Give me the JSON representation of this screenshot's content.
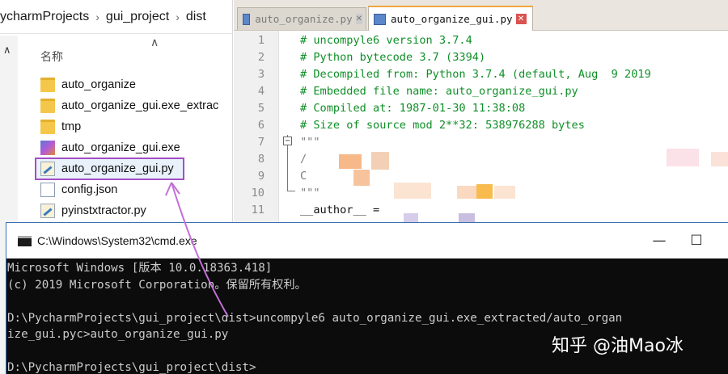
{
  "explorer": {
    "breadcrumb": [
      "ycharmProjects",
      "gui_project",
      "dist"
    ],
    "column_header": "名称",
    "files": [
      {
        "name": "auto_organize",
        "icon": "folder-icon"
      },
      {
        "name": "auto_organize_gui.exe_extrac",
        "icon": "folder-icon"
      },
      {
        "name": "tmp",
        "icon": "folder-icon"
      },
      {
        "name": "auto_organize_gui.exe",
        "icon": "exe-icon"
      },
      {
        "name": "auto_organize_gui.py",
        "icon": "python-file-icon",
        "selected": true
      },
      {
        "name": "config.json",
        "icon": "json-file-icon"
      },
      {
        "name": "pyinstxtractor.py",
        "icon": "python-file-icon"
      }
    ]
  },
  "editor": {
    "tabs": [
      {
        "label": "auto_organize.py",
        "active": false
      },
      {
        "label": "auto_organize_gui.py",
        "active": true
      }
    ],
    "lines": [
      {
        "n": "1",
        "text": "# uncompyle6 version 3.7.4",
        "kind": "cmt"
      },
      {
        "n": "2",
        "text": "# Python bytecode 3.7 (3394)",
        "kind": "cmt"
      },
      {
        "n": "3",
        "text": "# Decompiled from: Python 3.7.4 (default, Aug  9 2019",
        "kind": "cmt"
      },
      {
        "n": "4",
        "text": "# Embedded file name: auto_organize_gui.py",
        "kind": "cmt"
      },
      {
        "n": "5",
        "text": "# Compiled at: 1987-01-30 11:38:08",
        "kind": "cmt"
      },
      {
        "n": "6",
        "text": "# Size of source mod 2**32: 538976288 bytes",
        "kind": "cmt"
      },
      {
        "n": "7",
        "text": "\"\"\"",
        "kind": "str"
      },
      {
        "n": "8",
        "text": "/",
        "kind": "str"
      },
      {
        "n": "9",
        "text": "C",
        "kind": "str"
      },
      {
        "n": "10",
        "text": "\"\"\"",
        "kind": "str"
      },
      {
        "n": "11",
        "text": "__author__ =",
        "kind": "plain"
      }
    ],
    "fold_marker": "−"
  },
  "console": {
    "title": "C:\\Windows\\System32\\cmd.exe",
    "buttons": {
      "minimize": "—",
      "maximize": "☐",
      "close": "✕"
    },
    "lines": [
      "Microsoft Windows [版本 10.0.18363.418]",
      "(c) 2019 Microsoft Corporation。保留所有权利。",
      "",
      "D:\\PycharmProjects\\gui_project\\dist>uncompyle6 auto_organize_gui.exe_extracted/auto_organ",
      "ize_gui.pyc>auto_organize_gui.py",
      "",
      "D:\\PycharmProjects\\gui_project\\dist>"
    ]
  },
  "watermark": "知乎 @油Mao冰",
  "colors": {
    "comment": "#0f8f27",
    "selection_outline": "#a24fc4",
    "arrow": "#c46fd8",
    "console_bg": "#0c0c0c",
    "console_text": "#cccccc"
  }
}
